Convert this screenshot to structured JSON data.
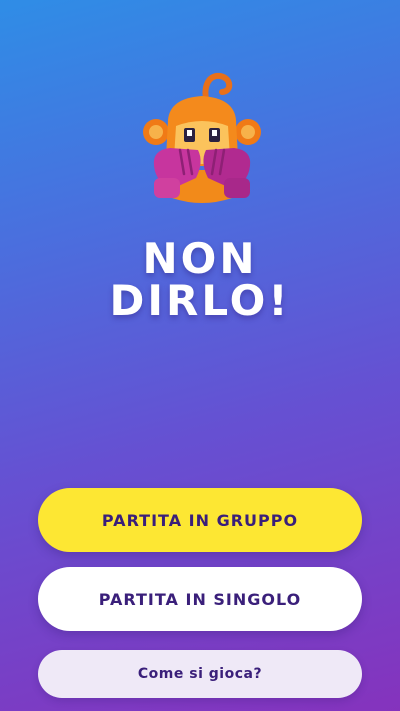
{
  "app": {
    "title_line1": "NON",
    "title_line2": "DIRLO!",
    "mascot": "monkey-speak-no-evil-icon"
  },
  "actions": {
    "group_play_label": "PARTITA IN GRUPPO",
    "single_play_label": "PARTITA IN SINGOLO",
    "how_to_play_label": "Come si gioca?"
  },
  "colors": {
    "background_top": "#2f8de6",
    "background_bottom": "#8533bd",
    "primary_button": "#fde733",
    "secondary_button": "#ffffff",
    "tertiary_button": "#efe9f7",
    "button_text": "#3a1f7a"
  }
}
